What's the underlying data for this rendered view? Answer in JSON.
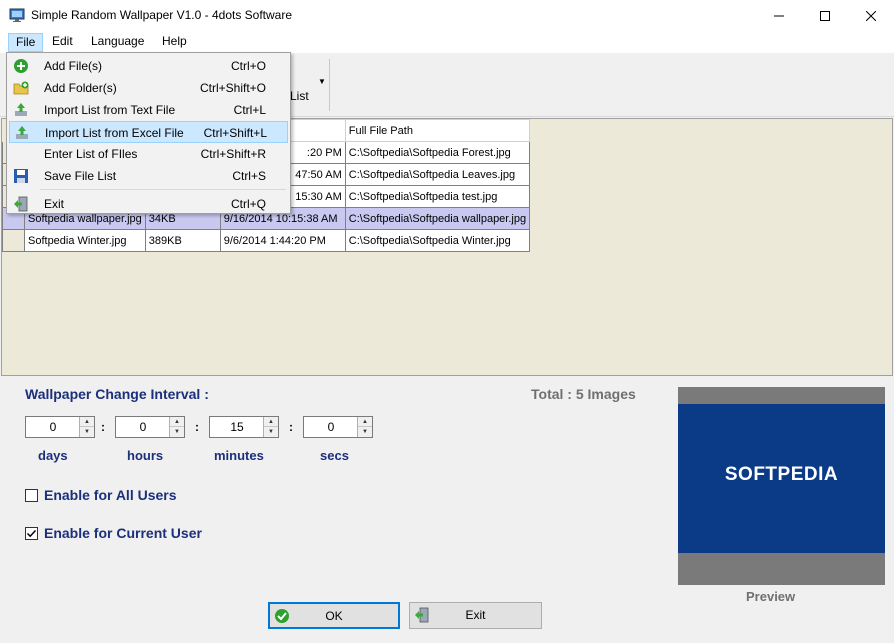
{
  "window": {
    "title": "Simple Random Wallpaper V1.0 - 4dots Software"
  },
  "menubar": {
    "file": "File",
    "edit": "Edit",
    "language": "Language",
    "help": "Help"
  },
  "toolbar": {
    "partial_label": "List"
  },
  "file_menu": {
    "items": [
      {
        "label": "Add File(s)",
        "shortcut": "Ctrl+O",
        "icon": "add-file-icon"
      },
      {
        "label": "Add Folder(s)",
        "shortcut": "Ctrl+Shift+O",
        "icon": "add-folder-icon"
      },
      {
        "label": "Import List from Text File",
        "shortcut": "Ctrl+L",
        "icon": "import-text-icon"
      },
      {
        "label": "Import List from Excel File",
        "shortcut": "Ctrl+Shift+L",
        "icon": "import-excel-icon"
      },
      {
        "label": "Enter List of FIles",
        "shortcut": "Ctrl+Shift+R",
        "icon": ""
      },
      {
        "label": "Save File List",
        "shortcut": "Ctrl+S",
        "icon": "save-icon"
      },
      {
        "label": "Exit",
        "shortcut": "Ctrl+Q",
        "icon": "exit-icon"
      }
    ]
  },
  "grid": {
    "header_path": "Full File Path",
    "rows": [
      {
        "name": "",
        "size": "",
        "date": ":20 PM",
        "path": "C:\\Softpedia\\Softpedia Forest.jpg"
      },
      {
        "name": "",
        "size": "",
        "date": "47:50 AM",
        "path": "C:\\Softpedia\\Softpedia Leaves.jpg"
      },
      {
        "name": "",
        "size": "",
        "date": "15:30 AM",
        "path": "C:\\Softpedia\\Softpedia test.jpg"
      },
      {
        "name": "Softpedia wallpaper.jpg",
        "size": "34KB",
        "date": "9/16/2014 10:15:38 AM",
        "path": "C:\\Softpedia\\Softpedia wallpaper.jpg"
      },
      {
        "name": "Softpedia Winter.jpg",
        "size": "389KB",
        "date": "9/6/2014 1:44:20 PM",
        "path": "C:\\Softpedia\\Softpedia Winter.jpg"
      }
    ]
  },
  "interval": {
    "title": "Wallpaper Change Interval :",
    "days": "0",
    "hours": "0",
    "minutes": "15",
    "secs": "0",
    "days_label": "days",
    "hours_label": "hours",
    "minutes_label": "minutes",
    "secs_label": "secs",
    "colon": ":"
  },
  "total": "Total : 5 Images",
  "options": {
    "all_users": {
      "label": "Enable for All Users",
      "checked": false
    },
    "current_user": {
      "label": "Enable for Current User",
      "checked": true
    }
  },
  "preview": {
    "logo_text": "SOFTPEDIA",
    "label": "Preview"
  },
  "buttons": {
    "ok": "OK",
    "exit": "Exit"
  },
  "colors": {
    "accent_text": "#1c2f7a",
    "selection": "#cce8ff",
    "preview_bg": "#0b3b86"
  }
}
